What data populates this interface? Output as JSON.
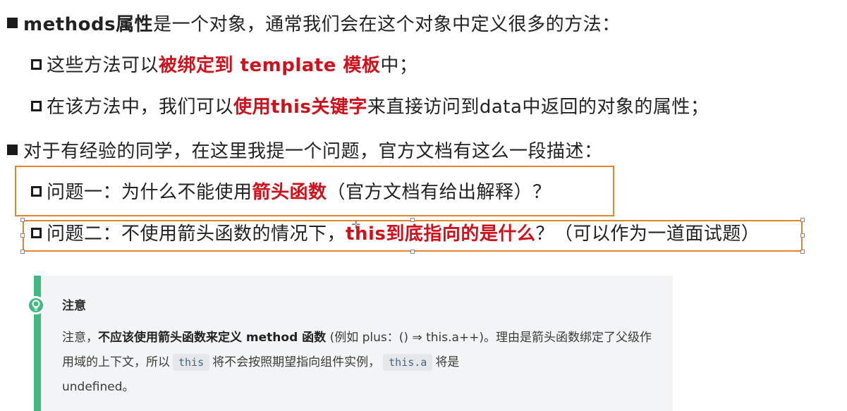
{
  "bullets": {
    "l1": {
      "part1": "methods属性",
      "part2": "是一个对象，通常我们会在这个对象中定义很多的方法："
    },
    "l2": {
      "part1": "这些方法可以",
      "part2": "被绑定到 template 模板",
      "part3": "中；"
    },
    "l3": {
      "part1": "在该方法中，我们可以",
      "part2": "使用this关键字",
      "part3": "来直接访问到data中返回的对象的属性；"
    },
    "l4": {
      "part1": "对于有经验的同学，在这里我提一个问题，官方文档有这么一段描述："
    },
    "l5": {
      "part1": "问题一：为什么不能使用",
      "part2": "箭头函数",
      "part3": "（官方文档有给出解释）？"
    },
    "l6": {
      "part1": "问题二：不使用箭头函数的情况下，",
      "part2": "this到底指向的是什么",
      "part3": "？（可以作为一道面试题）"
    }
  },
  "tip": {
    "icon": "lightbulb-icon",
    "title": "注意",
    "b1": "注意，",
    "b2": "不应该使用箭头函数来定义 method 函数",
    "b3": " (例如 plus：() ⇒ this.a++)。理由是箭头函数绑定了父级作用域的上下文，所以",
    "code1": "this",
    "b4": "将不会按照期望指向组件实例，",
    "code2": "this.a",
    "b5": "将是",
    "b6": "undefined。"
  },
  "colors": {
    "emphasis": "#d0101a",
    "highlight_border": "#e0852a",
    "tip_accent": "#42b883"
  }
}
